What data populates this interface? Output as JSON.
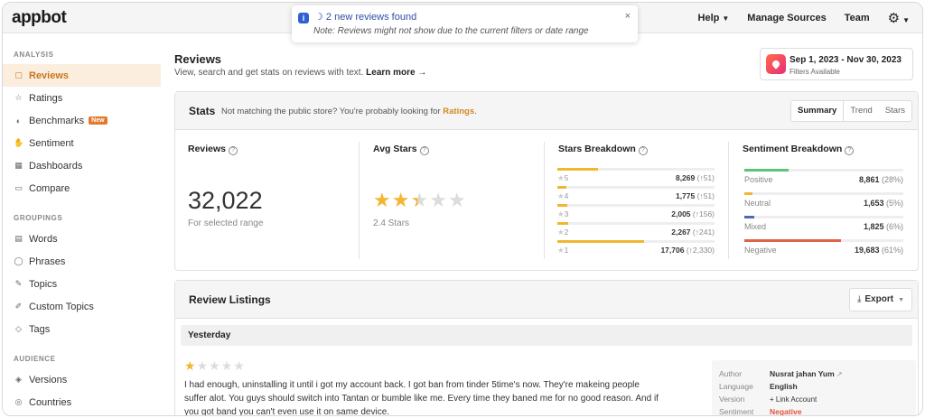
{
  "topbar": {
    "logo": "appbot",
    "nav": {
      "help": "Help",
      "manage_sources": "Manage Sources",
      "team": "Team"
    }
  },
  "toast": {
    "title": "2 new reviews found",
    "note": "Note: Reviews might not show due to the current filters or date range",
    "close": "×"
  },
  "sidebar": {
    "analysis_title": "ANALYSIS",
    "analysis_items": [
      {
        "label": "Reviews",
        "icon": "reviews-icon",
        "glyph": "▢"
      },
      {
        "label": "Ratings",
        "icon": "star-icon",
        "glyph": "☆"
      },
      {
        "label": "Benchmarks",
        "icon": "benchmarks-icon",
        "glyph": "◐",
        "badge": "New"
      },
      {
        "label": "Sentiment",
        "icon": "thumbs-up-icon",
        "glyph": "👍"
      },
      {
        "label": "Dashboards",
        "icon": "dashboard-icon",
        "glyph": "▦"
      },
      {
        "label": "Compare",
        "icon": "compare-icon",
        "glyph": "▭"
      }
    ],
    "groupings_title": "GROUPINGS",
    "groupings_items": [
      {
        "label": "Words",
        "icon": "words-icon",
        "glyph": "▤"
      },
      {
        "label": "Phrases",
        "icon": "phrases-icon",
        "glyph": "◯"
      },
      {
        "label": "Topics",
        "icon": "topics-icon",
        "glyph": "✎"
      },
      {
        "label": "Custom Topics",
        "icon": "custom-topics-icon",
        "glyph": "✐"
      },
      {
        "label": "Tags",
        "icon": "tag-icon",
        "glyph": "◇"
      }
    ],
    "audience_title": "AUDIENCE",
    "audience_items": [
      {
        "label": "Versions",
        "icon": "versions-icon",
        "glyph": "◈"
      },
      {
        "label": "Countries",
        "icon": "globe-icon",
        "glyph": "◎"
      }
    ]
  },
  "page": {
    "title": "Reviews",
    "subtitle": "View, search and get stats on reviews with text.",
    "learn_more": "Learn more →",
    "date_range": "Sep 1, 2023 - Nov 30, 2023",
    "filters": "Filters Available"
  },
  "stats": {
    "title": "Stats",
    "note": "Not matching the public store? You're probably looking for",
    "note_link": "Ratings",
    "note_end": ".",
    "tabs": [
      "Summary",
      "Trend",
      "Stars"
    ],
    "reviews_label": "Reviews",
    "reviews_value": "32,022",
    "reviews_sub": "For selected range",
    "avg_label": "Avg Stars",
    "avg_value": 2.4,
    "avg_sub": "2.4 Stars",
    "breakdown_label": "Stars Breakdown",
    "breakdown": [
      {
        "stars": "5",
        "count": "8,269",
        "delta": "(↑51)",
        "fraction": 0.258
      },
      {
        "stars": "4",
        "count": "1,775",
        "delta": "(↑51)",
        "fraction": 0.055
      },
      {
        "stars": "3",
        "count": "2,005",
        "delta": "(↑156)",
        "fraction": 0.063
      },
      {
        "stars": "2",
        "count": "2,267",
        "delta": "(↑241)",
        "fraction": 0.071
      },
      {
        "stars": "1",
        "count": "17,706",
        "delta": "(↑2,330)",
        "fraction": 0.553
      }
    ],
    "sentiment_label": "Sentiment Breakdown",
    "sentiment": [
      {
        "label": "Positive",
        "count": "8,861",
        "pct": "(28%)",
        "fraction": 0.28,
        "color": "#5cc47a"
      },
      {
        "label": "Neutral",
        "count": "1,653",
        "pct": "(5%)",
        "fraction": 0.05,
        "color": "#f2b632"
      },
      {
        "label": "Mixed",
        "count": "1,825",
        "pct": "(6%)",
        "fraction": 0.06,
        "color": "#4b6bb5"
      },
      {
        "label": "Negative",
        "count": "19,683",
        "pct": "(61%)",
        "fraction": 0.61,
        "color": "#e0634c"
      }
    ]
  },
  "listings": {
    "title": "Review Listings",
    "export": "Export",
    "group": "Yesterday",
    "review": {
      "rating": 1,
      "text": "I had enough, uninstalling it until i got my account back. I got ban from tinder 5time's now. They're makeing people suffer alot. You guys should switch into Tantan or bumble like me. Every time they baned me for no good reason. And if you got band you can't even use it on same device.",
      "meta": {
        "author_label": "Author",
        "author": "Nusrat jahan Yum",
        "language_label": "Language",
        "language": "English",
        "version_label": "Version",
        "version": "+ Link Account",
        "sentiment_label": "Sentiment",
        "sentiment": "Negative"
      }
    }
  },
  "colors": {
    "accent": "#d08a1f",
    "active_bg": "#fbeede",
    "star": "#f2b632"
  }
}
